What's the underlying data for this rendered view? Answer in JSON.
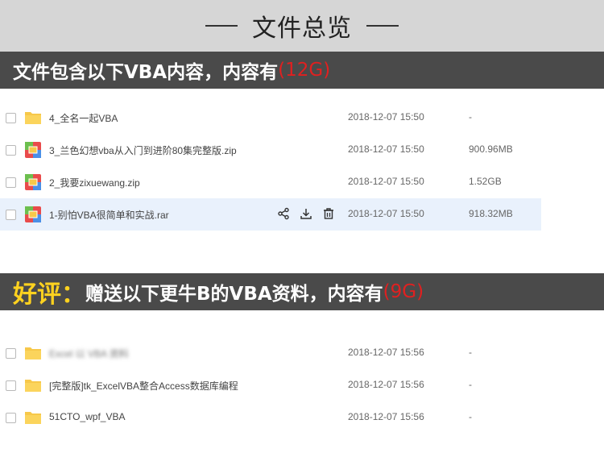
{
  "header": {
    "title": "文件总览"
  },
  "section1": {
    "banner_text": "文件包含以下VBA内容，内容有",
    "banner_size": "(12G)",
    "files": [
      {
        "type": "folder-icon",
        "name": "4_全名一起VBA",
        "date": "2018-12-07 15:50",
        "size": "-"
      },
      {
        "type": "zip-icon",
        "name": "3_兰色幻想vba从入门到进阶80集完整版.zip",
        "date": "2018-12-07 15:50",
        "size": "900.96MB"
      },
      {
        "type": "zip-icon",
        "name": "2_我要zixuewang.zip",
        "date": "2018-12-07 15:50",
        "size": "1.52GB"
      },
      {
        "type": "zip-icon",
        "name": "1-别怕VBA很简单和实战.rar",
        "date": "2018-12-07 15:50",
        "size": "918.32MB"
      }
    ]
  },
  "section2": {
    "banner_prefix": "好评",
    "banner_colon": "：",
    "banner_text": "赠送以下更牛B的VBA资料，内容有",
    "banner_size": "(9G)",
    "files": [
      {
        "type": "folder-icon",
        "name": "Excel 以 VBA 资料",
        "date": "2018-12-07 15:56",
        "size": "-"
      },
      {
        "type": "folder-icon",
        "name": "[完整版]tk_ExcelVBA整合Access数据库编程",
        "date": "2018-12-07 15:56",
        "size": "-"
      },
      {
        "type": "folder-icon",
        "name": "51CTO_wpf_VBA",
        "date": "2018-12-07 15:56",
        "size": "-"
      }
    ]
  },
  "colors": {
    "header_bg": "#d6d6d6",
    "banner_bg": "#4a4a4a",
    "highlight_red": "#e02020",
    "good_review_yellow": "#ffd21f",
    "folder": "#f7c84a",
    "hover_row": "#e9f1fc"
  }
}
